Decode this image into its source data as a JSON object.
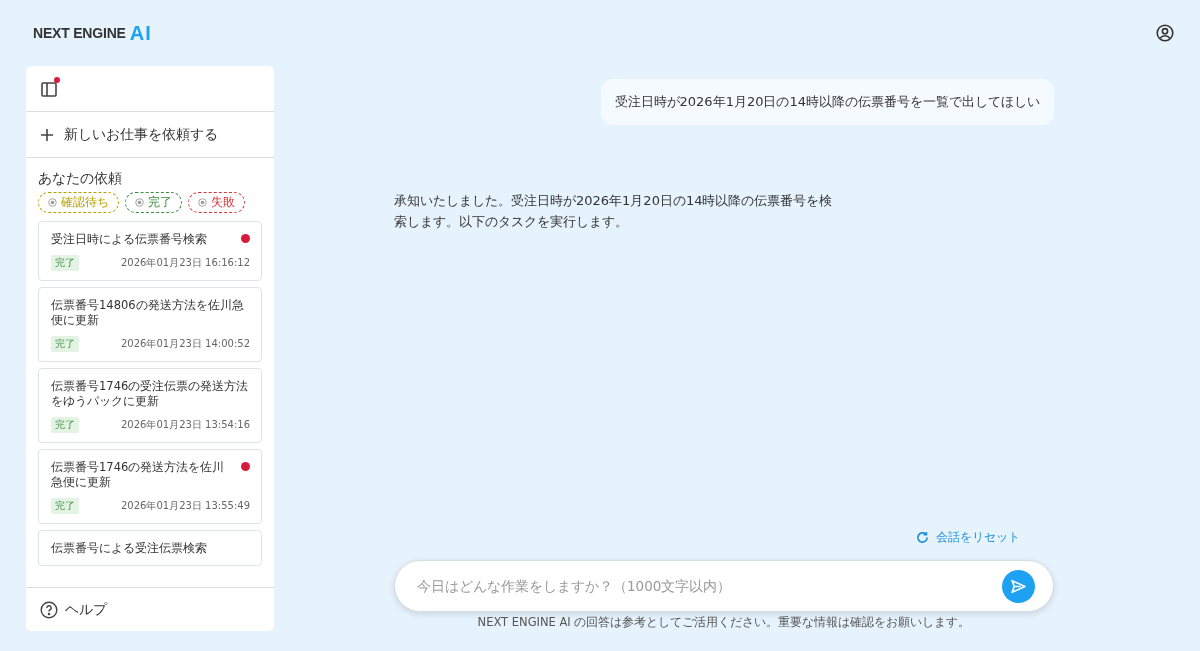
{
  "header": {
    "logo_text": "NEXT ENGINE",
    "logo_mark": "AI"
  },
  "sidebar": {
    "panel_toggle": {
      "notification": true
    },
    "new_task": "新しいお仕事を依頼する",
    "heading": "あなたの依頼",
    "filters": [
      {
        "label": "確認待ち",
        "color": "#b5a000"
      },
      {
        "label": "完了",
        "color": "#3d8b40"
      },
      {
        "label": "失敗",
        "color": "#d23838"
      }
    ],
    "tasks": [
      {
        "title": "受注日時による伝票番号検索",
        "status": "完了",
        "time": "2026年01月23日 16:16:12",
        "unread": true
      },
      {
        "title": "伝票番号14806の発送方法を佐川急便に更新",
        "status": "完了",
        "time": "2026年01月23日 14:00:52",
        "unread": false
      },
      {
        "title": "伝票番号1746の受注伝票の発送方法をゆうパックに更新",
        "status": "完了",
        "time": "2026年01月23日 13:54:16",
        "unread": false
      },
      {
        "title": "伝票番号1746の発送方法を佐川急便に更新",
        "status": "完了",
        "time": "2026年01月23日 13:55:49",
        "unread": true
      },
      {
        "title": "伝票番号による受注伝票検索",
        "unread": false
      }
    ],
    "help": "ヘルプ"
  },
  "chat": {
    "messages": [
      {
        "kind": "user",
        "text": "受注日時が2026年1月20日の14時以降の伝票番号を一覧で出してほしい"
      },
      {
        "kind": "assistant",
        "text": "承知いたしました。受注日時が2026年1月20日の14時以降の伝票番号を検索します。以下のタスクを実行します。"
      }
    ],
    "reset": "会話をリセット",
    "input": {
      "placeholder": "今日はどんな作業をしますか？（1000文字以内）"
    },
    "disclaimer": "NEXT ENGINE AI の回答は参考としてご活用ください。重要な情報は確認をお願いします。"
  }
}
